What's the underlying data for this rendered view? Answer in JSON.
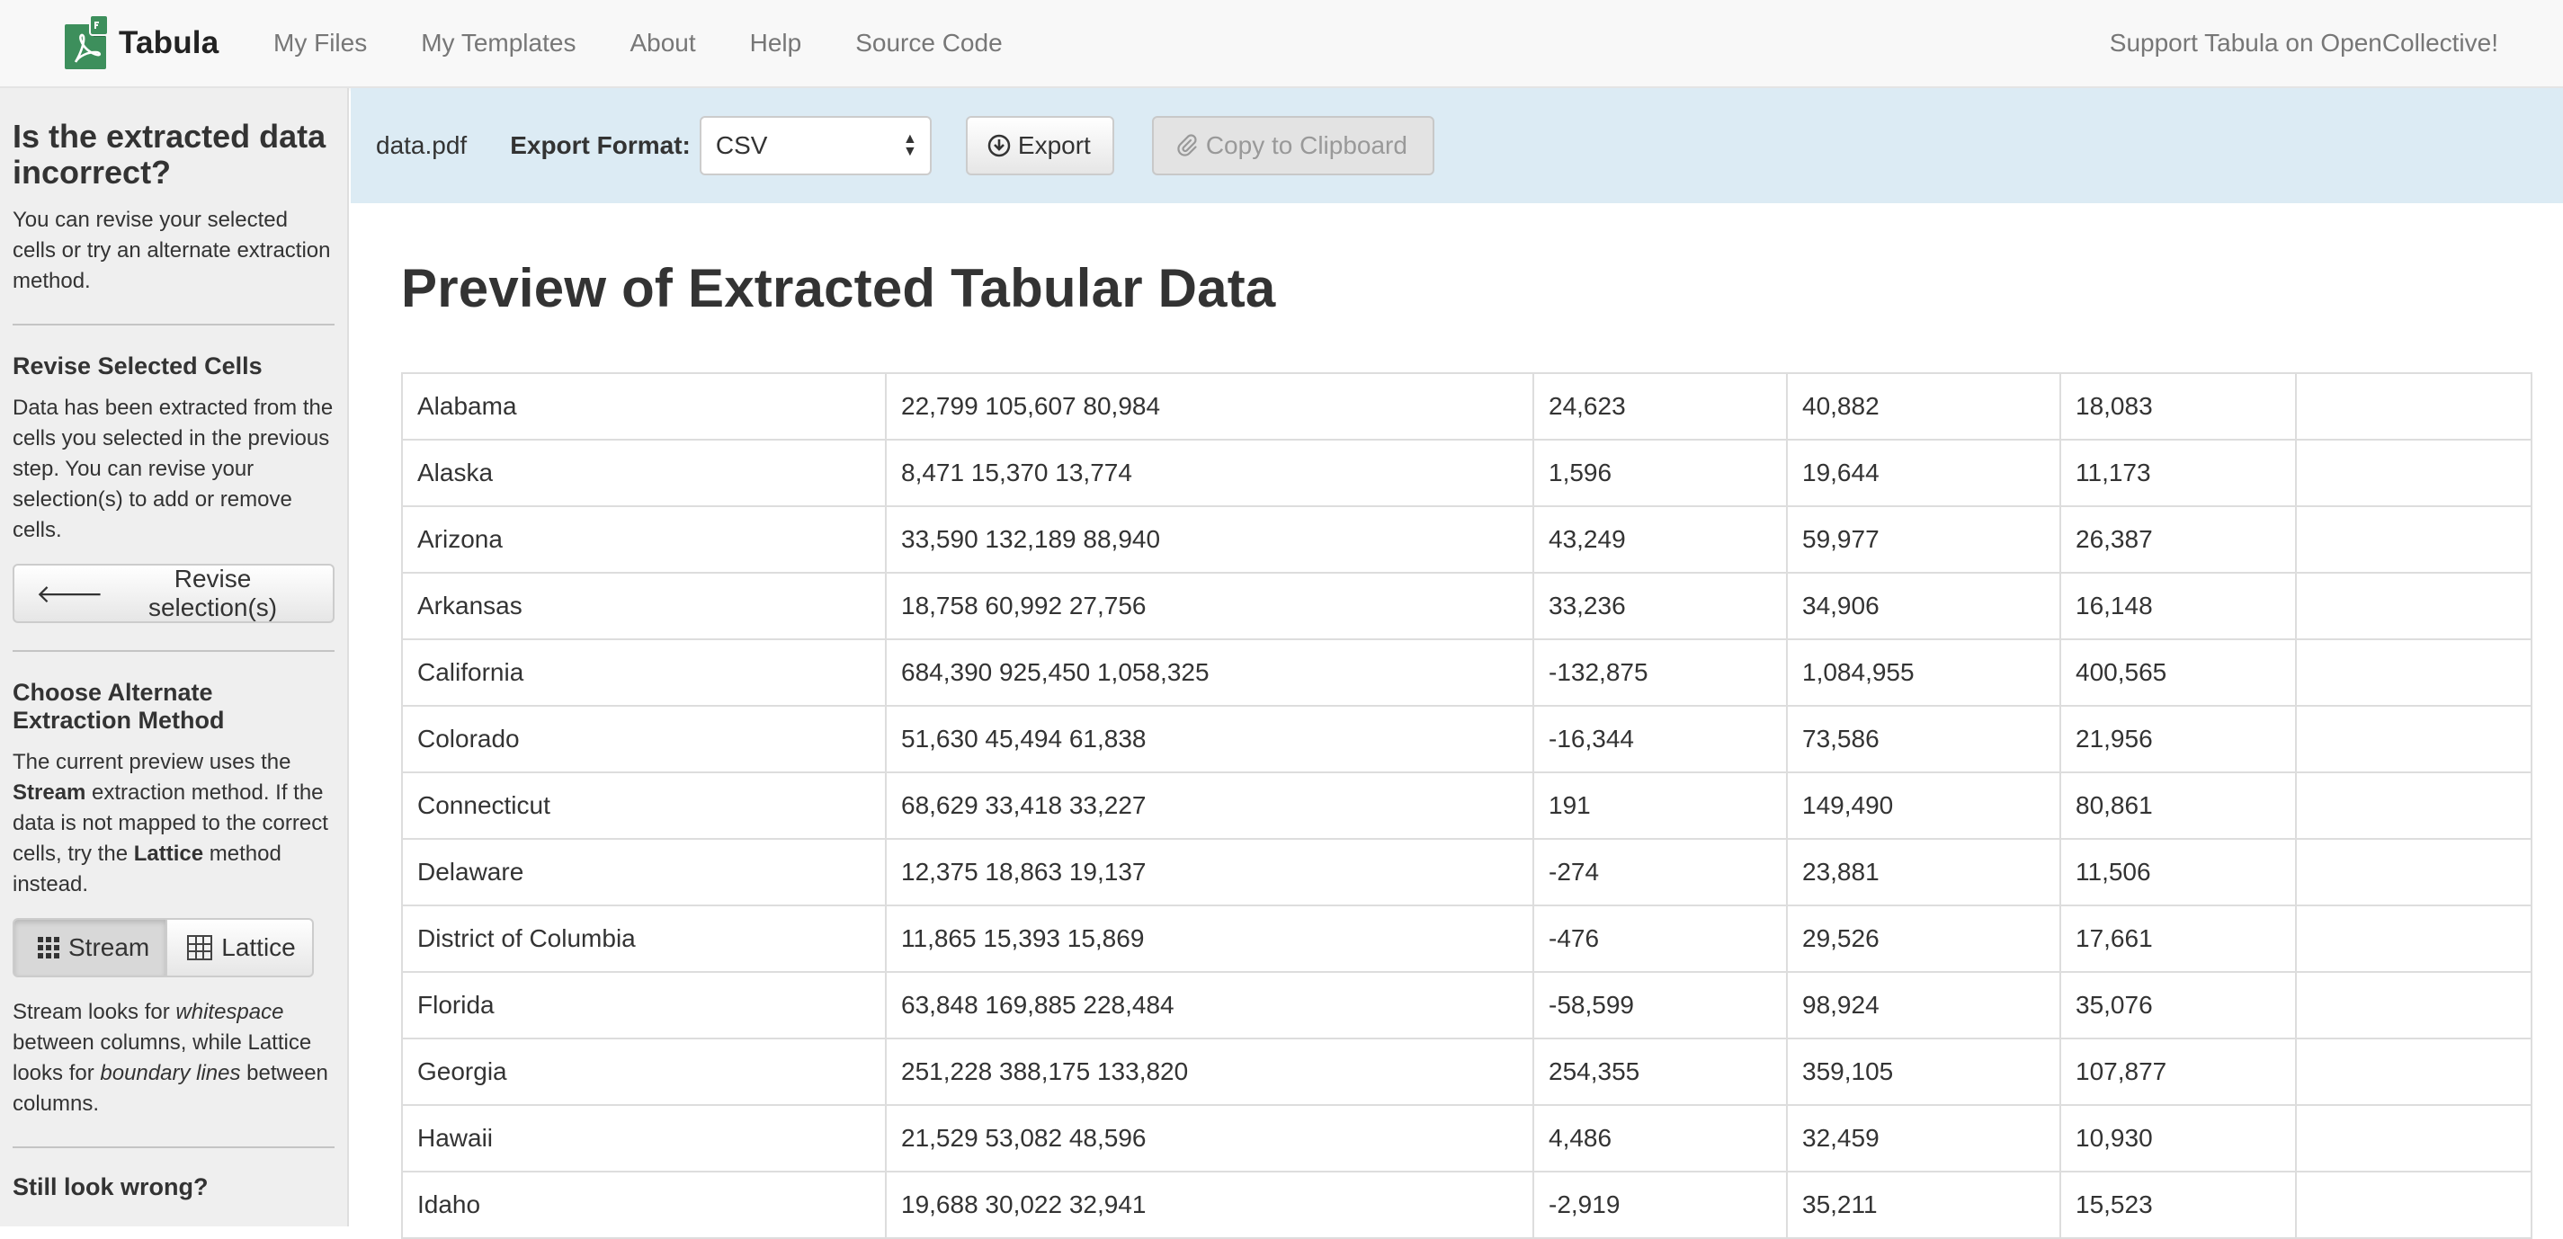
{
  "brand": {
    "name": "Tabula"
  },
  "nav": {
    "links": [
      "My Files",
      "My Templates",
      "About",
      "Help",
      "Source Code"
    ],
    "support": "Support Tabula on OpenCollective!"
  },
  "sidebar": {
    "title": "Is the extracted data incorrect?",
    "intro": "You can revise your selected cells or try an alternate extraction method.",
    "revise": {
      "title": "Revise Selected Cells",
      "text": "Data has been extracted from the cells you selected in the previous step. You can revise your selection(s) to add or remove cells.",
      "button": "Revise selection(s)"
    },
    "method": {
      "title": "Choose Alternate Extraction Method",
      "text_1": "The current preview uses the ",
      "current": "Stream",
      "text_2": " extraction method. If the data is not mapped to the correct cells, try the ",
      "alternate": "Lattice",
      "text_3": " method instead.",
      "stream_label": "Stream",
      "lattice_label": "Lattice",
      "desc_1": "Stream looks for ",
      "desc_em1": "whitespace",
      "desc_2": " between columns, while Lattice looks for ",
      "desc_em2": "boundary lines",
      "desc_3": " between columns."
    },
    "still_wrong": "Still look wrong?"
  },
  "export_bar": {
    "filename": "data.pdf",
    "format_label": "Export Format:",
    "format_value": "CSV",
    "export_button": "Export",
    "copy_button": "Copy to Clipboard"
  },
  "preview": {
    "title": "Preview of Extracted Tabular Data",
    "rows": [
      [
        "Alabama",
        "22,799 105,607 80,984",
        "24,623",
        "40,882",
        "18,083",
        ""
      ],
      [
        "Alaska",
        "8,471 15,370 13,774",
        "1,596",
        "19,644",
        "11,173",
        ""
      ],
      [
        "Arizona",
        "33,590 132,189 88,940",
        "43,249",
        "59,977",
        "26,387",
        ""
      ],
      [
        "Arkansas",
        "18,758 60,992 27,756",
        "33,236",
        "34,906",
        "16,148",
        ""
      ],
      [
        "California",
        "684,390 925,450 1,058,325",
        "-132,875",
        "1,084,955",
        "400,565",
        ""
      ],
      [
        "Colorado",
        "51,630 45,494 61,838",
        "-16,344",
        "73,586",
        "21,956",
        ""
      ],
      [
        "Connecticut",
        "68,629 33,418 33,227",
        "191",
        "149,490",
        "80,861",
        ""
      ],
      [
        "Delaware",
        "12,375 18,863 19,137",
        "-274",
        "23,881",
        "11,506",
        ""
      ],
      [
        "District of Columbia",
        "11,865 15,393 15,869",
        "-476",
        "29,526",
        "17,661",
        ""
      ],
      [
        "Florida",
        "63,848 169,885 228,484",
        "-58,599",
        "98,924",
        "35,076",
        ""
      ],
      [
        "Georgia",
        "251,228 388,175 133,820",
        "254,355",
        "359,105",
        "107,877",
        ""
      ],
      [
        "Hawaii",
        "21,529 53,082 48,596",
        "4,486",
        "32,459",
        "10,930",
        ""
      ],
      [
        "Idaho",
        "19,688 30,022 32,941",
        "-2,919",
        "35,211",
        "15,523",
        ""
      ]
    ]
  }
}
